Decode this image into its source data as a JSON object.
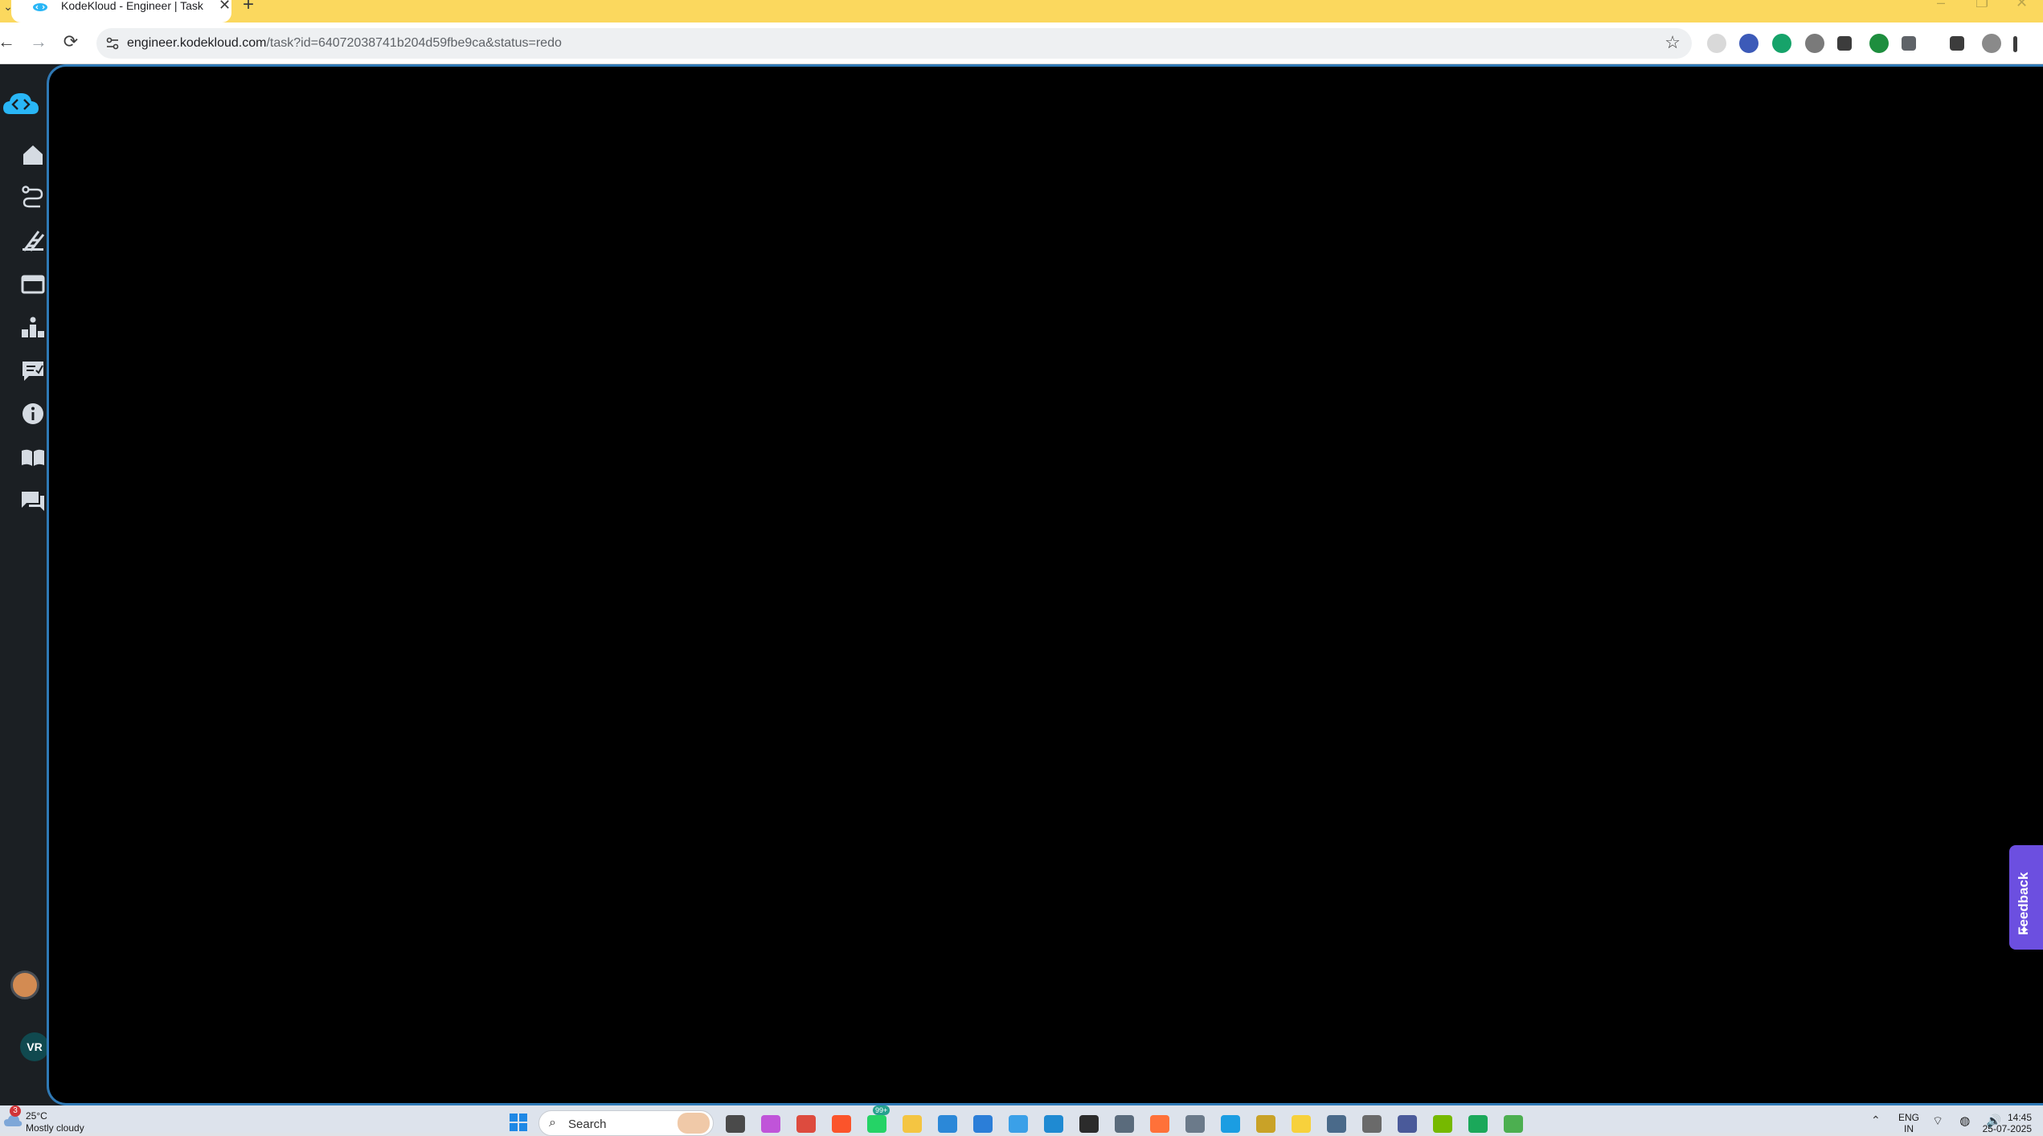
{
  "browser": {
    "tab": {
      "title": "KodeKloud - Engineer | Task",
      "close_label": "✕"
    },
    "new_tab_label": "+",
    "tab_search_label": "⌄",
    "window_controls": {
      "minimize": "–",
      "restore": "❐",
      "close": "✕"
    },
    "url_host": "engineer.kodekloud.com",
    "url_path": "/task?id=64072038741b204d59fbe9ca&status=redo",
    "nav": {
      "back": "←",
      "forward": "→",
      "reload": "⟳"
    },
    "bookmark_icon": "☆",
    "extensions": [
      {
        "icon": "loading-extension-icon",
        "color": "#d9d9d9"
      },
      {
        "icon": "globe-extension-icon",
        "color": "#3c5ab8"
      },
      {
        "icon": "grammarly-icon",
        "color": "#16a36a"
      },
      {
        "icon": "pen-extension-icon",
        "color": "#7a7a7a"
      },
      {
        "icon": "download-box-icon",
        "color": "#3c3c3c"
      },
      {
        "icon": "download-arrow-icon",
        "color": "#1e8e3e"
      },
      {
        "icon": "puzzle-icon",
        "color": "#5f6368"
      },
      {
        "icon": "media-queue-icon",
        "color": "#3c3c3c"
      },
      {
        "icon": "profile-avatar-icon",
        "color": "#8a8a8a"
      },
      {
        "icon": "kebab-menu-icon",
        "color": "#3c3c3c"
      }
    ]
  },
  "app": {
    "brand_color": "#29b6f6",
    "frame_border_color": "#2f79b5",
    "sidebar_icons": [
      "home-icon",
      "path-icon",
      "ladder-icon",
      "projects-icon",
      "leaderboard-icon",
      "tasks-icon",
      "info-icon",
      "docs-icon",
      "chat-icon"
    ],
    "user_initials": "VR",
    "feedback_label": "Feedback",
    "feedback_spark": "✦"
  },
  "taskbar": {
    "weather": {
      "badge": "3",
      "temp": "25°C",
      "desc": "Mostly cloudy"
    },
    "search_placeholder": "Search",
    "search_icon": "⌕",
    "apps": [
      {
        "icon": "task-view-icon",
        "color": "#4a4a4a"
      },
      {
        "icon": "copilot-icon",
        "color": "#c054d9"
      },
      {
        "icon": "chrome-icon",
        "color": "#dd4b3e"
      },
      {
        "icon": "brave-icon",
        "color": "#fb542b"
      },
      {
        "icon": "whatsapp-icon",
        "color": "#25d366"
      },
      {
        "icon": "file-explorer-icon",
        "color": "#f4c542"
      },
      {
        "icon": "store-icon",
        "color": "#2b88d8"
      },
      {
        "icon": "photos-icon",
        "color": "#2b7ed8"
      },
      {
        "icon": "mail-icon",
        "color": "#3aa0e8"
      },
      {
        "icon": "vscode-icon",
        "color": "#1f8ad2"
      },
      {
        "icon": "terminal-icon",
        "color": "#2b2b2b"
      },
      {
        "icon": "calculator-icon",
        "color": "#5a6b7c"
      },
      {
        "icon": "firefox-icon",
        "color": "#ff7139"
      },
      {
        "icon": "remote-desktop-icon",
        "color": "#6b7a8a"
      },
      {
        "icon": "edge-icon",
        "color": "#1b9de2"
      },
      {
        "icon": "git-icon",
        "color": "#c9a227"
      },
      {
        "icon": "sticky-notes-icon",
        "color": "#f7d13c"
      },
      {
        "icon": "snipping-tool-icon",
        "color": "#4a6a8a"
      },
      {
        "icon": "clock-app-icon",
        "color": "#6a6a6a"
      },
      {
        "icon": "office-icon",
        "color": "#4a5a9a"
      },
      {
        "icon": "nvidia-icon",
        "color": "#76b900"
      },
      {
        "icon": "spotify-like-icon",
        "color": "#1ba85a"
      },
      {
        "icon": "notepad-icon",
        "color": "#4caf50"
      }
    ],
    "whatsapp_badge": "99+",
    "chevron": "⌃",
    "lang_line1": "ENG",
    "lang_line2": "IN",
    "tray": "⌔ ◍ 🔊",
    "time": "14:45",
    "date": "25-07-2025"
  }
}
